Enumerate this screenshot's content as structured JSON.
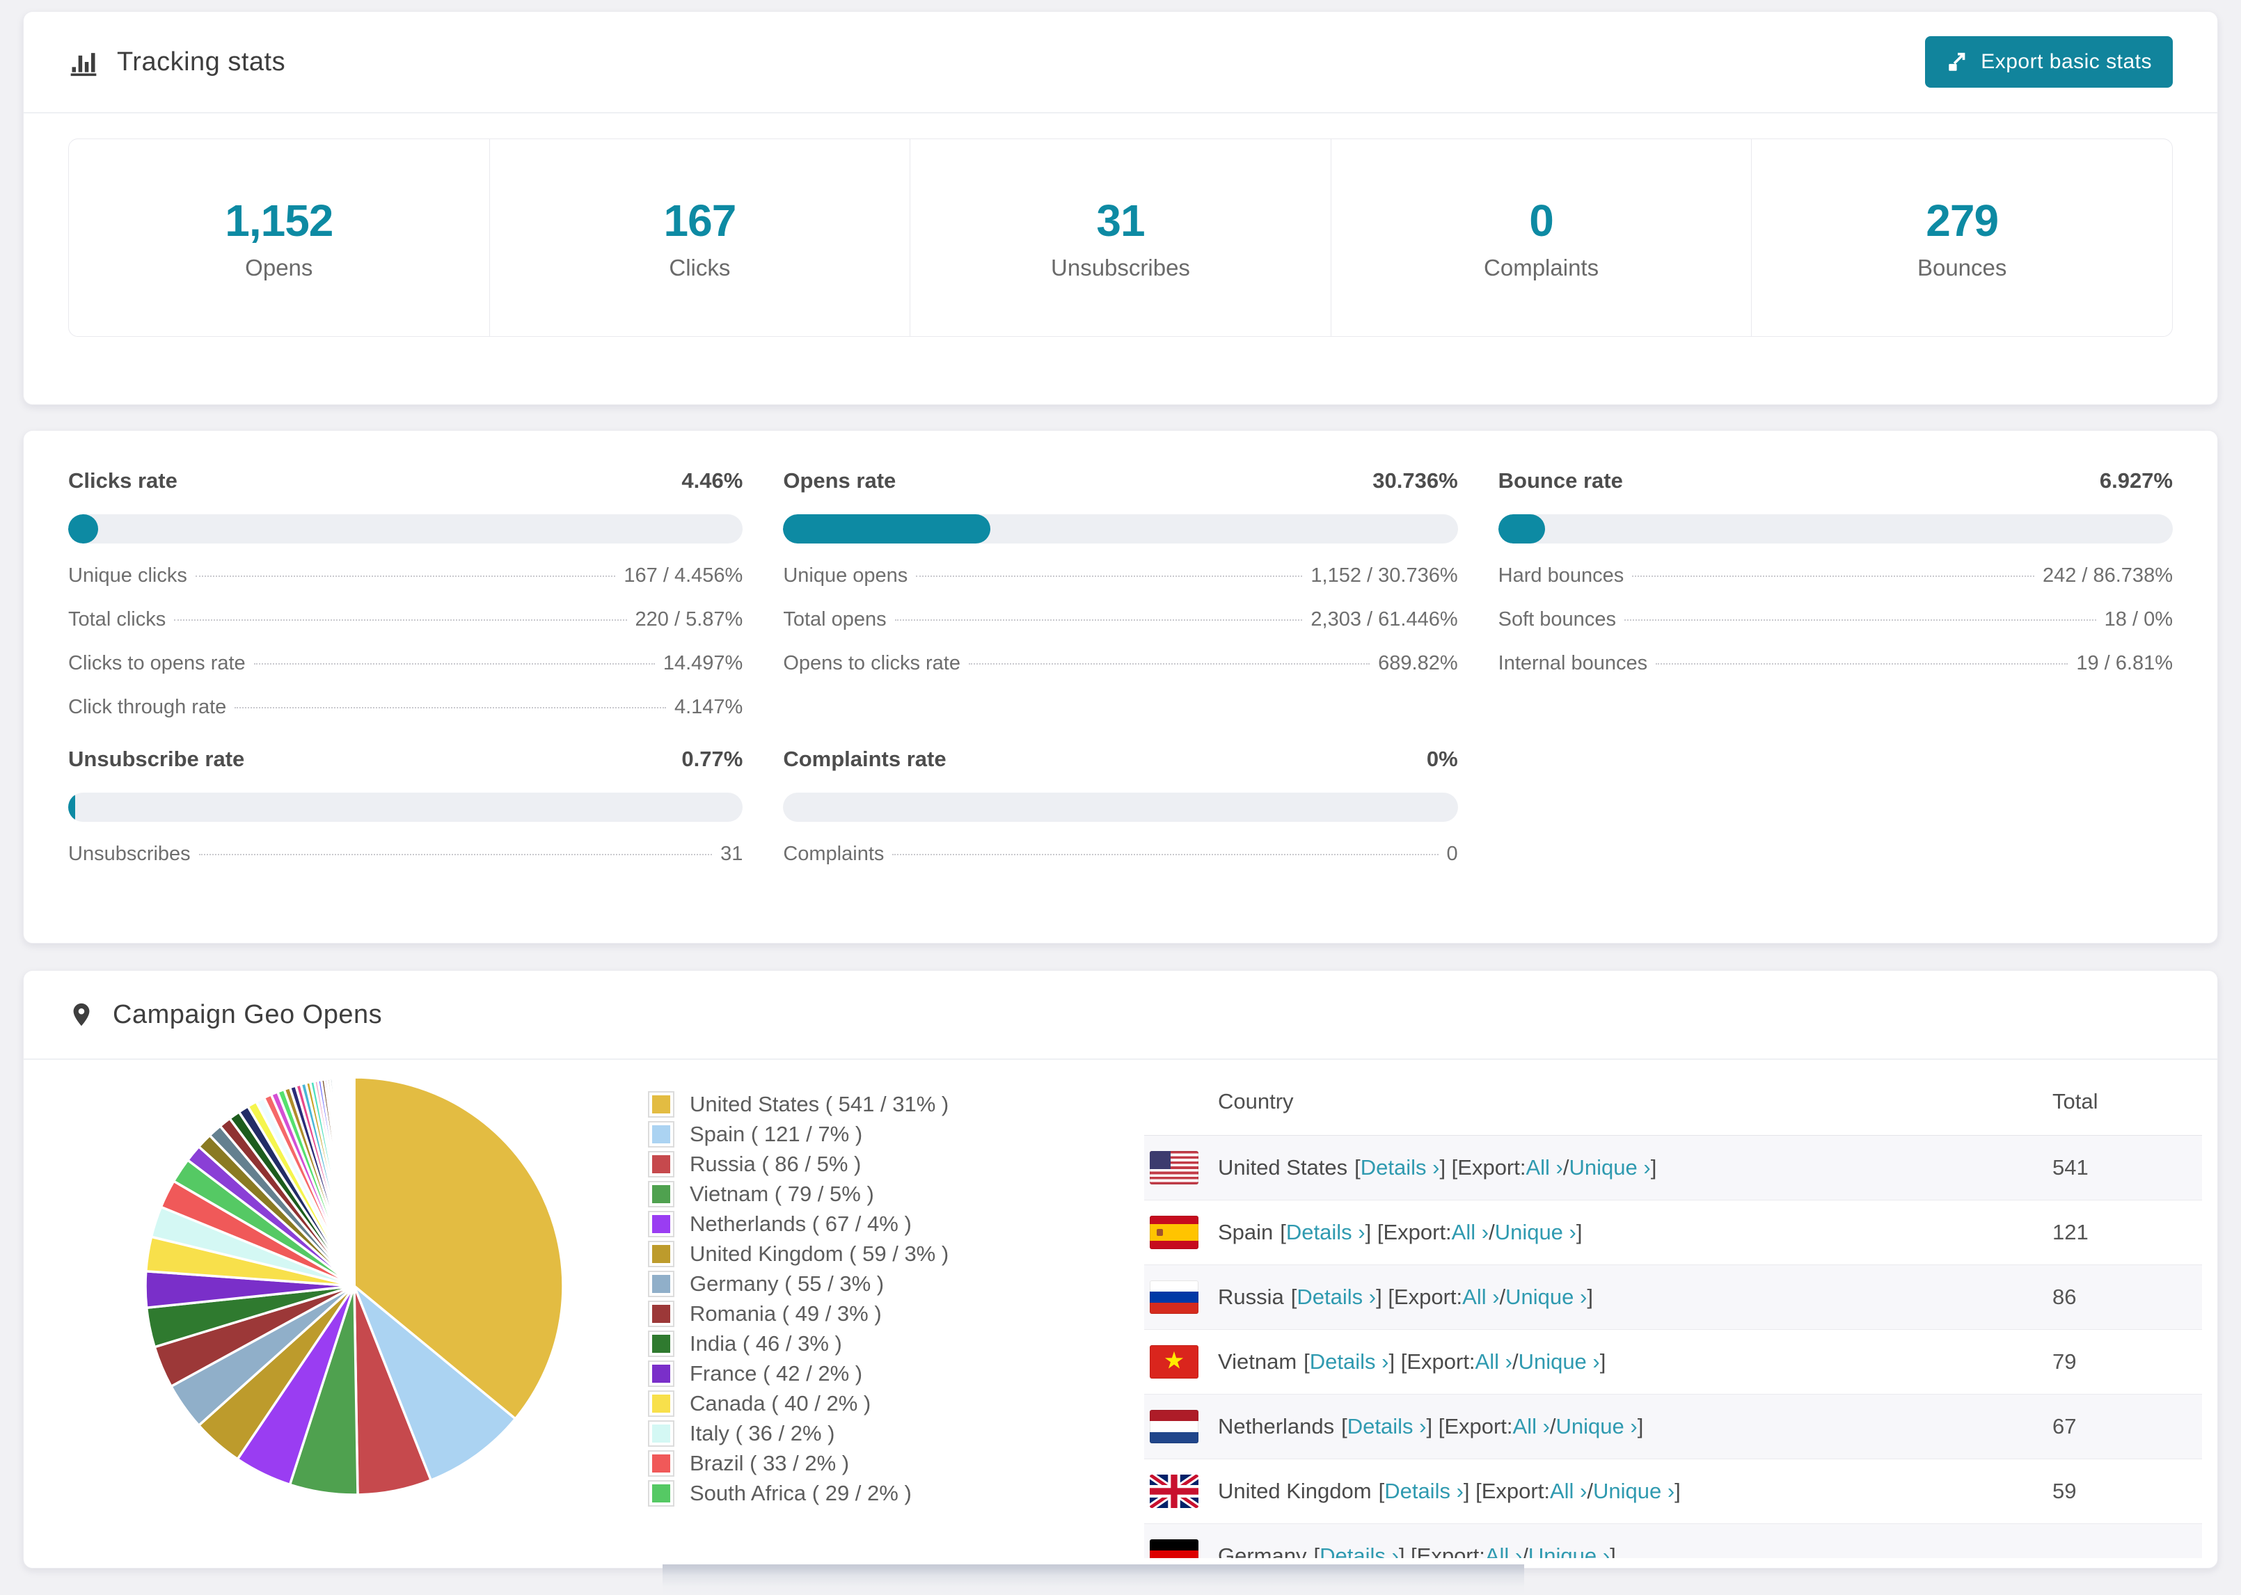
{
  "accent": "#0d8aa3",
  "tracking": {
    "title": "Tracking stats",
    "export_button_label": "Export basic stats",
    "stats": [
      {
        "value": "1,152",
        "label": "Opens"
      },
      {
        "value": "167",
        "label": "Clicks"
      },
      {
        "value": "31",
        "label": "Unsubscribes"
      },
      {
        "value": "0",
        "label": "Complaints"
      },
      {
        "value": "279",
        "label": "Bounces"
      }
    ]
  },
  "rates": {
    "blocks": [
      {
        "title": "Clicks rate",
        "value": "4.46%",
        "percent": 4.46,
        "rows": [
          {
            "label": "Unique clicks",
            "value": "167 / 4.456%"
          },
          {
            "label": "Total clicks",
            "value": "220 / 5.87%"
          },
          {
            "label": "Clicks to opens rate",
            "value": "14.497%"
          },
          {
            "label": "Click through rate",
            "value": "4.147%"
          }
        ]
      },
      {
        "title": "Opens rate",
        "value": "30.736%",
        "percent": 30.736,
        "rows": [
          {
            "label": "Unique opens",
            "value": "1,152 / 30.736%"
          },
          {
            "label": "Total opens",
            "value": "2,303 / 61.446%"
          },
          {
            "label": "Opens to clicks rate",
            "value": "689.82%"
          }
        ]
      },
      {
        "title": "Bounce rate",
        "value": "6.927%",
        "percent": 6.927,
        "rows": [
          {
            "label": "Hard bounces",
            "value": "242 / 86.738%"
          },
          {
            "label": "Soft bounces",
            "value": "18 / 0%"
          },
          {
            "label": "Internal bounces",
            "value": "19 / 6.81%"
          }
        ]
      },
      {
        "title": "Unsubscribe rate",
        "value": "0.77%",
        "percent": 0.77,
        "rows": [
          {
            "label": "Unsubscribes",
            "value": "31"
          }
        ]
      },
      {
        "title": "Complaints rate",
        "value": "0%",
        "percent": 0,
        "rows": [
          {
            "label": "Complaints",
            "value": "0"
          }
        ]
      }
    ]
  },
  "geo": {
    "title": "Campaign Geo Opens",
    "table": {
      "headers": [
        "Country",
        "Total"
      ],
      "details_label": "Details ›",
      "export_label": "Export:",
      "all_label": "All ›",
      "unique_label": "Unique ›",
      "rows": [
        {
          "country": "United States",
          "flag": "us",
          "total": "541",
          "partial": false
        },
        {
          "country": "Spain",
          "flag": "es",
          "total": "121",
          "partial": false
        },
        {
          "country": "Russia",
          "flag": "ru",
          "total": "86",
          "partial": false
        },
        {
          "country": "Vietnam",
          "flag": "vn",
          "total": "79",
          "partial": false
        },
        {
          "country": "Netherlands",
          "flag": "nl",
          "total": "67",
          "partial": false
        },
        {
          "country": "United Kingdom",
          "flag": "gb",
          "total": "59",
          "partial": false
        },
        {
          "country": "Germany",
          "flag": "de",
          "total": "",
          "partial": true
        }
      ]
    }
  },
  "chart_data": {
    "type": "pie",
    "title": "Campaign Geo Opens",
    "legend_position": "right",
    "labels": [
      "United States",
      "Spain",
      "Russia",
      "Vietnam",
      "Netherlands",
      "United Kingdom",
      "Germany",
      "Romania",
      "India",
      "France",
      "Canada",
      "Italy",
      "Brazil",
      "South Africa"
    ],
    "values": [
      541,
      121,
      86,
      79,
      67,
      59,
      55,
      49,
      46,
      42,
      40,
      36,
      33,
      29
    ],
    "percent_labels": [
      31,
      7,
      5,
      5,
      4,
      3,
      3,
      3,
      3,
      2,
      2,
      2,
      2,
      2
    ],
    "colors": [
      "#e3bc42",
      "#abd3f2",
      "#c6494d",
      "#4fa14f",
      "#9a3df2",
      "#bd9b2c",
      "#90afc9",
      "#9c3838",
      "#2f7a2f",
      "#7a2fc9",
      "#f8e04b",
      "#d4f8f4",
      "#f05959",
      "#55c964"
    ],
    "others_values": [
      20,
      18,
      16,
      14,
      13,
      12,
      11,
      10,
      9,
      8,
      8,
      7,
      7,
      6,
      6,
      5,
      5,
      4,
      4,
      4,
      3,
      3,
      3,
      2,
      2,
      2,
      2,
      2,
      1,
      1,
      1,
      1,
      1,
      1,
      1,
      1,
      1,
      1,
      1,
      1,
      1,
      1,
      1
    ],
    "others_colors_cycle": [
      "#8a3fd6",
      "#8a7a22",
      "#64808f",
      "#8f3232",
      "#1d5c1d",
      "#222c66",
      "#f5f54d",
      "#eefcff",
      "#f56868",
      "#d44fd4",
      "#55e06e",
      "#b08c2a",
      "#2c2c78",
      "#e8488a",
      "#49b6d6",
      "#c9a227",
      "#4fe0c0",
      "#f2a0c0",
      "#6b6bff",
      "#7a5230"
    ]
  }
}
